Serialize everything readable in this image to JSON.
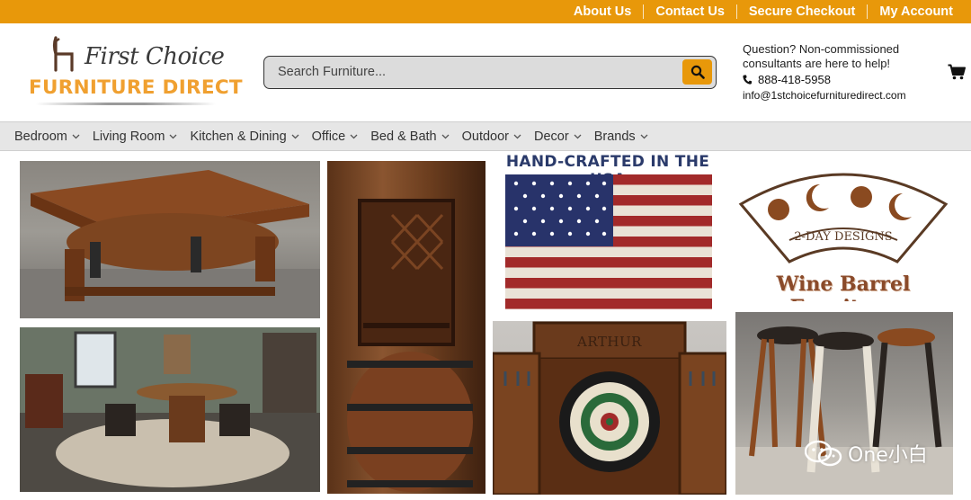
{
  "topbar": {
    "links": [
      "About Us",
      "Contact Us",
      "Secure Checkout",
      "My Account"
    ]
  },
  "brand": {
    "script_name": "First Choice",
    "main_name": "FURNITURE DIRECT"
  },
  "search": {
    "placeholder": "Search Furniture..."
  },
  "contact": {
    "question": "Question? Non-commissioned consultants are here to help!",
    "phone": "888-418-5958",
    "email": "info@1stchoicefurnituredirect.com"
  },
  "nav": {
    "items": [
      "Bedroom",
      "Living Room",
      "Kitchen & Dining",
      "Office",
      "Bed & Bath",
      "Outdoor",
      "Decor",
      "Brands"
    ]
  },
  "collage": {
    "flag_caption": "HAND-CRAFTED IN THE USA",
    "logo_badge_text": "2-DAY DESIGNS",
    "wine_caption": "Wine Barrel Furniture",
    "dartboard_label": "ARTHUR"
  },
  "watermark": {
    "text": "One小白"
  },
  "colors": {
    "accent": "#e8980a",
    "logo_orange": "#f0a030",
    "nav_bg": "#e6e6e6"
  },
  "icons": {
    "search": "search-icon",
    "phone": "phone-icon",
    "cart": "cart-icon",
    "nav_chevron": "chevron-down-icon"
  }
}
